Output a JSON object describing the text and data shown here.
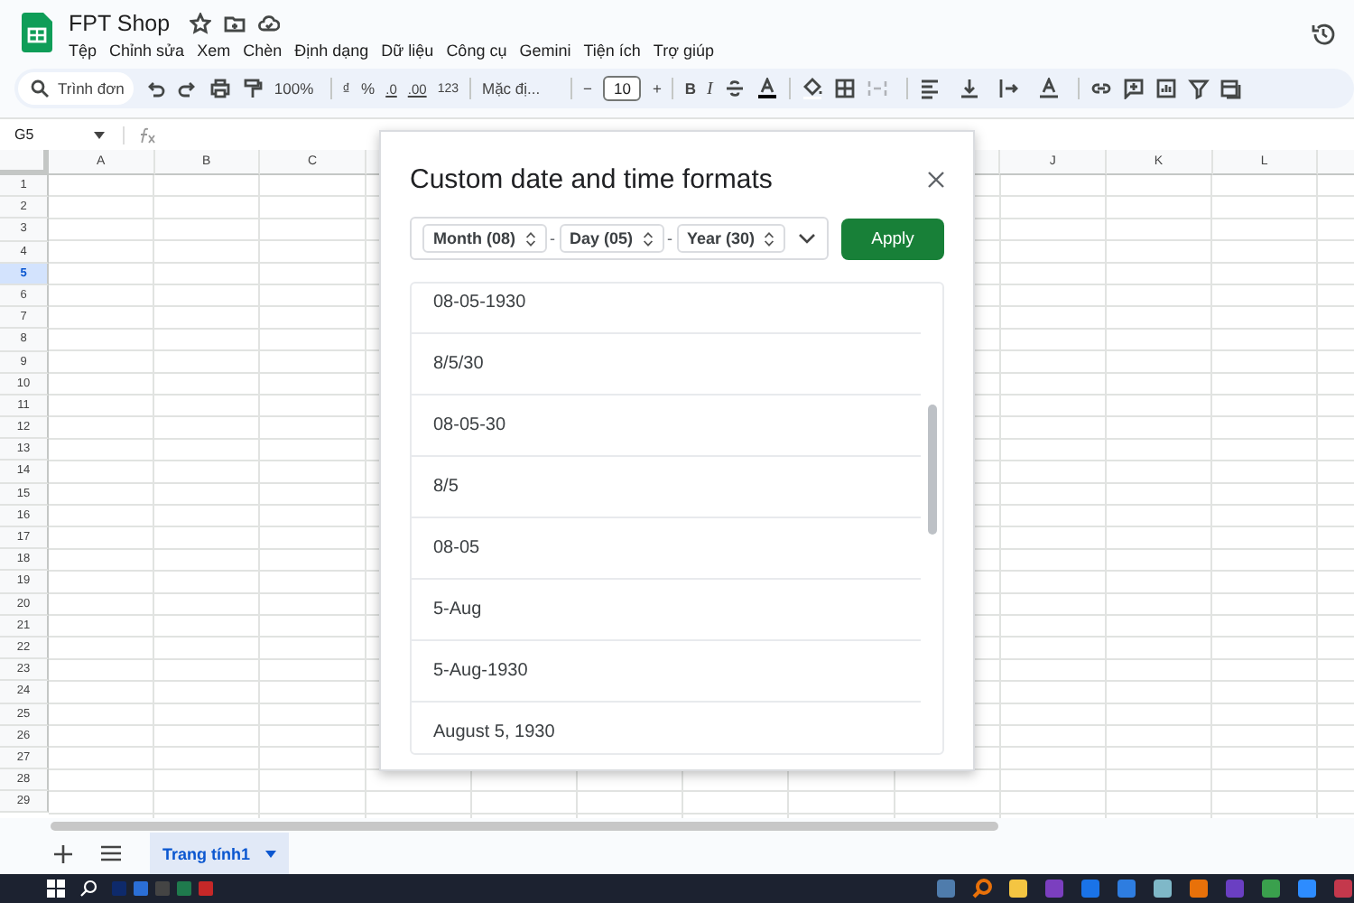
{
  "document": {
    "title": "FPT Shop"
  },
  "menu": [
    "Tệp",
    "Chỉnh sửa",
    "Xem",
    "Chèn",
    "Định dạng",
    "Dữ liệu",
    "Công cụ",
    "Gemini",
    "Tiện ích",
    "Trợ giúp"
  ],
  "toolbar": {
    "search_placeholder": "Trình đơn",
    "zoom": "100%",
    "currency": "₫",
    "percent": "%",
    "decrease_decimals": ".0",
    "increase_decimals": ".00",
    "number_format": "123",
    "font": "Mặc đị...",
    "font_size": "10",
    "font_size_minus": "−",
    "font_size_plus": "+",
    "bold": "B",
    "italic": "I"
  },
  "formula_bar": {
    "cell": "G5"
  },
  "columns_left": [
    "A",
    "B",
    "C"
  ],
  "columns_right": [
    "J",
    "K",
    "L"
  ],
  "rows": [
    {
      "label": "1",
      "selected": false
    },
    {
      "label": "2",
      "selected": false
    },
    {
      "label": "3",
      "selected": false
    },
    {
      "label": "4",
      "selected": false
    },
    {
      "label": "5",
      "selected": true
    },
    {
      "label": "6",
      "selected": false
    },
    {
      "label": "7",
      "selected": false
    },
    {
      "label": "8",
      "selected": false
    },
    {
      "label": "9",
      "selected": false
    },
    {
      "label": "10",
      "selected": false
    },
    {
      "label": "11",
      "selected": false
    },
    {
      "label": "12",
      "selected": false
    },
    {
      "label": "13",
      "selected": false
    },
    {
      "label": "14",
      "selected": false
    },
    {
      "label": "15",
      "selected": false
    },
    {
      "label": "16",
      "selected": false
    },
    {
      "label": "17",
      "selected": false
    },
    {
      "label": "18",
      "selected": false
    },
    {
      "label": "19",
      "selected": false
    },
    {
      "label": "20",
      "selected": false
    },
    {
      "label": "21",
      "selected": false
    },
    {
      "label": "22",
      "selected": false
    },
    {
      "label": "23",
      "selected": false
    },
    {
      "label": "24",
      "selected": false
    },
    {
      "label": "25",
      "selected": false
    },
    {
      "label": "26",
      "selected": false
    },
    {
      "label": "27",
      "selected": false
    },
    {
      "label": "28",
      "selected": false
    },
    {
      "label": "29",
      "selected": false
    }
  ],
  "sheet_tabs": [
    {
      "label": "Trang tính1",
      "selected": true
    }
  ],
  "dialog": {
    "title": "Custom date and time formats",
    "parts": [
      {
        "kind": "part",
        "label": "Month (08)"
      },
      {
        "kind": "separator",
        "label": "-"
      },
      {
        "kind": "part",
        "label": "Day (05)"
      },
      {
        "kind": "separator",
        "label": "-"
      },
      {
        "kind": "part",
        "label": "Year (30)"
      }
    ],
    "apply": "Apply",
    "formats": [
      "08-05-1930",
      "8/5/30",
      "08-05-30",
      "8/5",
      "08-05",
      "5-Aug",
      "5-Aug-1930",
      "August 5, 1930"
    ]
  }
}
